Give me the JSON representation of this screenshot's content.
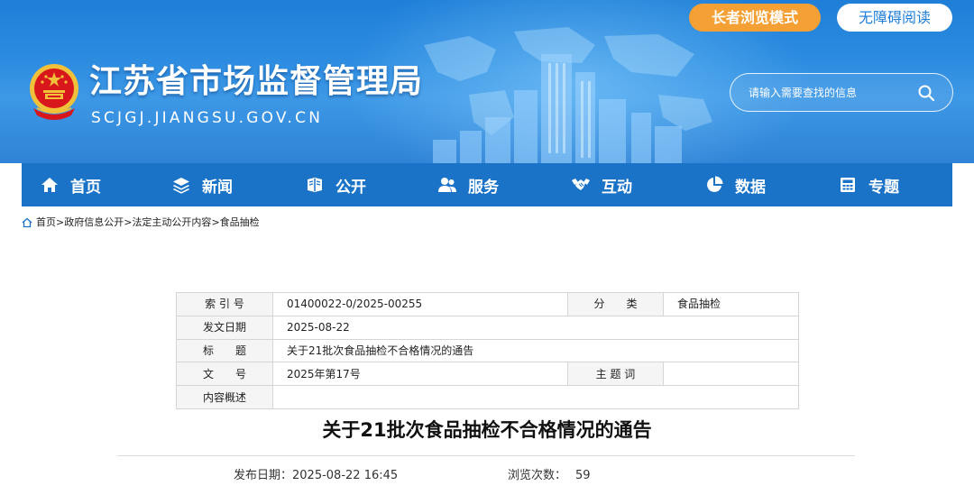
{
  "header": {
    "site_title": "江苏省市场监督管理局",
    "site_domain": "SCJGJ.JIANGSU.GOV.CN",
    "elder_mode_label": "长者浏览模式",
    "accessibility_label": "无障碍阅读",
    "search": {
      "placeholder": "请输入需要查找的信息"
    }
  },
  "nav": {
    "items": [
      {
        "label": "首页",
        "icon": "home-icon"
      },
      {
        "label": "新闻",
        "icon": "layers-icon"
      },
      {
        "label": "公开",
        "icon": "open-book-icon"
      },
      {
        "label": "服务",
        "icon": "users-icon"
      },
      {
        "label": "互动",
        "icon": "handshake-icon"
      },
      {
        "label": "数据",
        "icon": "pie-chart-icon"
      },
      {
        "label": "专题",
        "icon": "calculator-icon"
      }
    ]
  },
  "breadcrumb": {
    "items": [
      "首页",
      "政府信息公开",
      "法定主动公开内容",
      "食品抽检"
    ],
    "separator": ">"
  },
  "meta": {
    "index_label": "索 引 号",
    "index_value": "01400022-0/2025-00255",
    "category_label": "分　　类",
    "category_value": "食品抽检",
    "date_label": "发文日期",
    "date_value": "2025-08-22",
    "title_label": "标　　题",
    "title_value": "关于21批次食品抽检不合格情况的通告",
    "doc_no_label": "文　　号",
    "doc_no_value": "2025年第17号",
    "keywords_label": "主 题 词",
    "keywords_value": "",
    "summary_label": "内容概述",
    "summary_value": ""
  },
  "article": {
    "title": "关于21批次食品抽检不合格情况的通告",
    "publish_label": "发布日期：",
    "publish_value": "2025-08-22 16:45",
    "views_label": "浏览次数：",
    "views_value": "59"
  },
  "colors": {
    "header_blue": "#2b8be0",
    "nav_blue": "#1a73c7",
    "elder_orange": "#f4a034",
    "emblem_red": "#d7171b",
    "emblem_gold": "#f2c13a"
  }
}
